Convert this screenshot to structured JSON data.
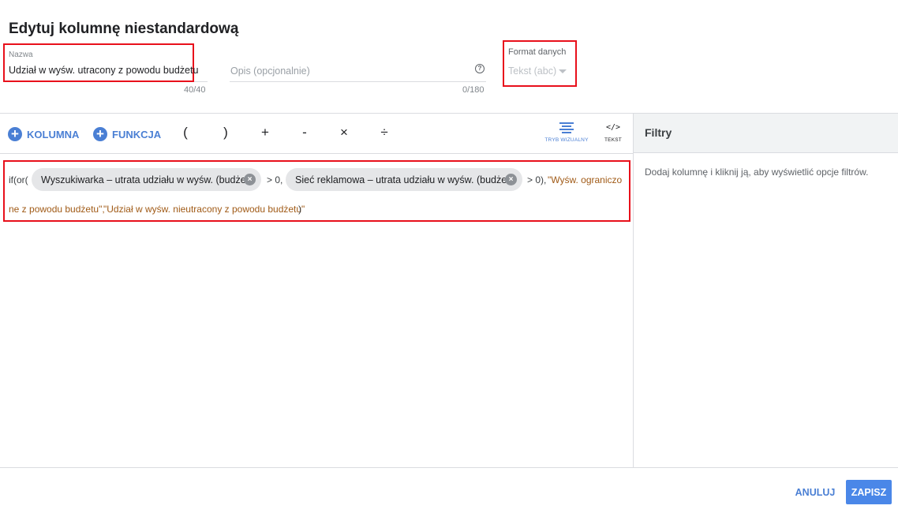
{
  "dialog": {
    "title": "Edytuj kolumnę niestandardową"
  },
  "name_field": {
    "label": "Nazwa",
    "value": "Udział w wyśw. utracony z powodu budżetu",
    "counter": "40/40"
  },
  "description_field": {
    "placeholder": "Opis (opcjonalnie)",
    "counter": "0/180",
    "help_icon": "help-circle-icon"
  },
  "format_field": {
    "label": "Format danych",
    "value": "Tekst (abc)"
  },
  "toolbar": {
    "column_label": "KOLUMNA",
    "function_label": "FUNKCJA",
    "operators": [
      "(",
      ")",
      "+",
      "-",
      "×",
      "÷"
    ],
    "visual_mode_label": "TRYB WIZUALNY",
    "text_mode_label": "TEKST",
    "text_mode_glyph": "</>"
  },
  "formula": {
    "prefix": "if(or(",
    "chip1": "Wyszukiwarka – utrata udziału w wyśw. (budżet)",
    "mid": "> 0,",
    "chip2": "Sieć reklamowa – utrata udziału w wyśw. (budżet)",
    "after_chip2": "> 0),",
    "string1_line1": "\"Wyśw. ograniczo",
    "string1_line2": "ne z powodu budżetu\",",
    "string2": "\"Udział w wyśw. nieutracony z powodu budżetu\"",
    "suffix": ")"
  },
  "filters": {
    "title": "Filtry",
    "hint": "Dodaj kolumnę i kliknij ją, aby wyświetlić opcje filtrów."
  },
  "footer": {
    "cancel_label": "ANULUJ",
    "save_label": "ZAPISZ"
  },
  "colors": {
    "accent": "#4a7fd4",
    "highlight": "#e8101b",
    "string_literal": "#a05a16"
  }
}
